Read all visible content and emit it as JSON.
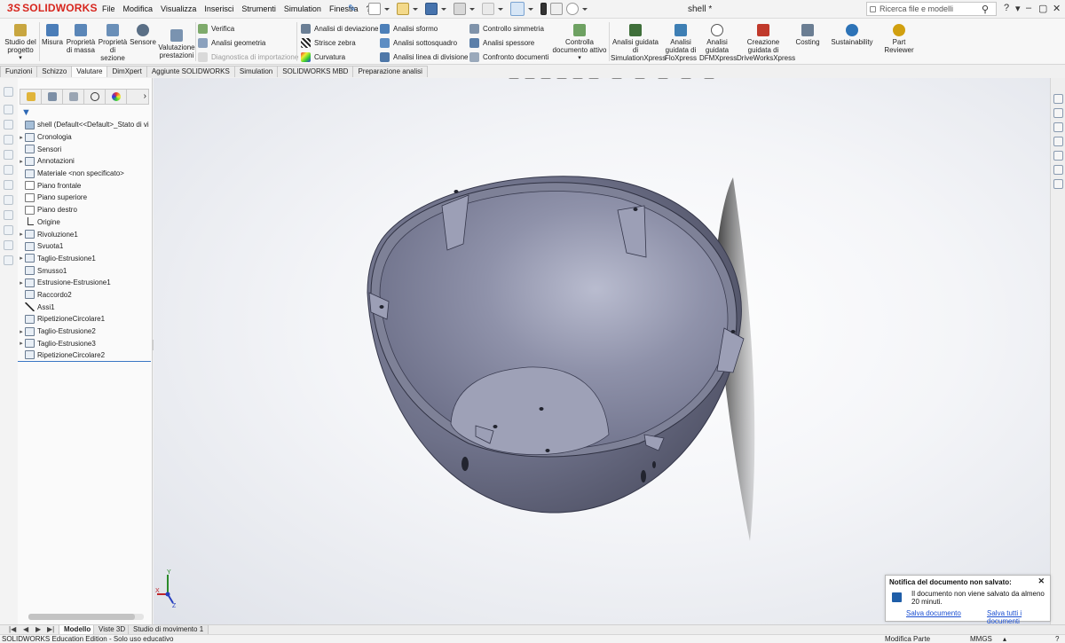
{
  "app": {
    "logo": "SOLIDWORKS",
    "document_title": "shell *",
    "search_placeholder": "Ricerca file e modelli"
  },
  "menu": [
    "File",
    "Modifica",
    "Visualizza",
    "Inserisci",
    "Strumenti",
    "Simulation",
    "Finestra",
    "?"
  ],
  "command_manager": {
    "big": [
      {
        "label": "Studio del progetto",
        "icon": "design-study-icon",
        "color": "#c8a640"
      },
      {
        "label": "Misura",
        "icon": "measure-icon",
        "color": "#4a7db8"
      },
      {
        "label": "Proprietà di massa",
        "icon": "mass-properties-icon",
        "color": "#5a86b8"
      },
      {
        "label": "Proprietà di sezione",
        "icon": "section-properties-icon",
        "color": "#6a8fb8"
      },
      {
        "label": "Sensore",
        "icon": "sensor-icon",
        "color": "#5a6f86"
      },
      {
        "label": "Valutazione prestazioni",
        "icon": "performance-icon",
        "color": "#7a93b0"
      }
    ],
    "col1": [
      {
        "label": "Verifica",
        "icon": "check-icon",
        "disabled": false
      },
      {
        "label": "Analisi geometria",
        "icon": "geometry-analysis-icon",
        "disabled": false
      },
      {
        "label": "Diagnostica di importazione",
        "icon": "import-diagnostics-icon",
        "disabled": true
      }
    ],
    "col2": [
      {
        "label": "Analisi di deviazione",
        "icon": "deviation-analysis-icon"
      },
      {
        "label": "Strisce zebra",
        "icon": "zebra-stripes-icon"
      },
      {
        "label": "Curvatura",
        "icon": "curvature-icon"
      }
    ],
    "col3": [
      {
        "label": "Analisi sformo",
        "icon": "draft-analysis-icon"
      },
      {
        "label": "Analisi sottosquadro",
        "icon": "undercut-analysis-icon"
      },
      {
        "label": "Analisi linea di divisione",
        "icon": "parting-line-icon"
      }
    ],
    "col4": [
      {
        "label": "Controllo simmetria",
        "icon": "symmetry-check-icon"
      },
      {
        "label": "Analisi spessore",
        "icon": "thickness-analysis-icon"
      },
      {
        "label": "Confronto documenti",
        "icon": "compare-documents-icon"
      }
    ],
    "check_active": "Controlla documento attivo",
    "xpress": [
      {
        "label": "Analisi guidata di SimulationXpress",
        "icon": "simulationxpress-icon",
        "color": "#3f6f3a"
      },
      {
        "label": "Analisi guidata di FloXpress",
        "icon": "floxpress-icon",
        "color": "#3e7fb4"
      },
      {
        "label": "Analisi guidata DFMXpress",
        "icon": "dfmxpress-icon",
        "color": "#555555"
      },
      {
        "label": "Creazione guidata di DriveWorksXpress",
        "icon": "driveworksxpress-icon",
        "color": "#c0392b"
      },
      {
        "label": "Costing",
        "icon": "costing-icon",
        "color": "#6b7e93"
      },
      {
        "label": "Sustainability",
        "icon": "sustainability-icon",
        "color": "#2d73b7"
      },
      {
        "label": "Part Reviewer",
        "icon": "part-reviewer-icon",
        "color": "#d1a010"
      }
    ]
  },
  "tabs": [
    "Funzioni",
    "Schizzo",
    "Valutare",
    "DimXpert",
    "Aggiunte SOLIDWORKS",
    "Simulation",
    "SOLIDWORKS MBD",
    "Preparazione analisi"
  ],
  "active_tab": "Valutare",
  "feature_tree": [
    {
      "label": "shell  (Default<<Default>_Stato di vi",
      "expand": false,
      "kind": "root"
    },
    {
      "label": "Cronologia",
      "expand": true,
      "kind": "folder"
    },
    {
      "label": "Sensori",
      "expand": false,
      "kind": "folder"
    },
    {
      "label": "Annotazioni",
      "expand": true,
      "kind": "folder"
    },
    {
      "label": "Materiale <non specificato>",
      "expand": false,
      "kind": "material"
    },
    {
      "label": "Piano frontale",
      "expand": false,
      "kind": "plane"
    },
    {
      "label": "Piano superiore",
      "expand": false,
      "kind": "plane"
    },
    {
      "label": "Piano destro",
      "expand": false,
      "kind": "plane"
    },
    {
      "label": "Origine",
      "expand": false,
      "kind": "origin"
    },
    {
      "label": "Rivoluzione1",
      "expand": true,
      "kind": "feature"
    },
    {
      "label": "Svuota1",
      "expand": false,
      "kind": "feature"
    },
    {
      "label": "Taglio-Estrusione1",
      "expand": true,
      "kind": "feature"
    },
    {
      "label": "Smusso1",
      "expand": false,
      "kind": "feature"
    },
    {
      "label": "Estrusione-Estrusione1",
      "expand": true,
      "kind": "feature"
    },
    {
      "label": "Raccordo2",
      "expand": false,
      "kind": "feature"
    },
    {
      "label": "Assi1",
      "expand": false,
      "kind": "axis"
    },
    {
      "label": "RipetizioneCircolare1",
      "expand": false,
      "kind": "feature"
    },
    {
      "label": "Taglio-Estrusione2",
      "expand": true,
      "kind": "feature"
    },
    {
      "label": "Taglio-Estrusione3",
      "expand": true,
      "kind": "feature"
    },
    {
      "label": "RipetizioneCircolare2",
      "expand": false,
      "kind": "feature"
    }
  ],
  "notification": {
    "title": "Notifica del documento non salvato:",
    "message": "Il documento non viene salvato da almeno 20 minuti.",
    "link_save": "Salva documento",
    "link_save_all": "Salva tutti i documenti"
  },
  "bottom_tabs": [
    "Modello",
    "Viste 3D",
    "Studio di movimento 1"
  ],
  "active_bottom_tab": "Modello",
  "status": {
    "edition": "SOLIDWORKS Education Edition - Solo uso educativo",
    "mode": "Modifica Parte",
    "units": "MMGS"
  },
  "triad": {
    "x": "X",
    "y": "Y",
    "z": "Z"
  }
}
